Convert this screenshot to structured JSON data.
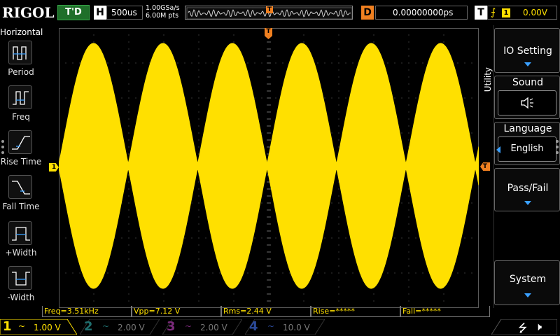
{
  "brand": "RIGOL",
  "topbar": {
    "run_state": "T'D",
    "horizontal_label": "H",
    "timebase": "500us",
    "sample_rate": "1.00GSa/s",
    "memory_depth": "6.00M pts",
    "delay_label": "D",
    "delay_value": "0.00000000ps",
    "trigger_label": "T",
    "trigger_source": "1",
    "trigger_level": "0.00V",
    "trigger_marker": "T"
  },
  "left_panel": {
    "title": "Horizontal",
    "items": [
      {
        "label": "Period",
        "icon": "period-icon"
      },
      {
        "label": "Freq",
        "icon": "freq-icon"
      },
      {
        "label": "Rise Time",
        "icon": "rise-time-icon"
      },
      {
        "label": "Fall Time",
        "icon": "fall-time-icon"
      },
      {
        "label": "+Width",
        "icon": "positive-width-icon"
      },
      {
        "label": "-Width",
        "icon": "negative-width-icon"
      }
    ]
  },
  "markers": {
    "ch1": "1",
    "trigger": "T"
  },
  "waveform": {
    "color": "#ffe000",
    "bursts": 6
  },
  "measurements": [
    {
      "text": "Freq=3.51kHz"
    },
    {
      "text": "Vpp=7.12 V"
    },
    {
      "text": "Rms=2.44 V"
    },
    {
      "text": "Rise=*****"
    },
    {
      "text": "Fall=*****"
    }
  ],
  "channels": [
    {
      "num": "1",
      "coupling": "~",
      "scale": "1.00 V",
      "color": "#ffe000",
      "active": true
    },
    {
      "num": "2",
      "coupling": "~",
      "scale": "2.00 V",
      "color": "#2aa3a3",
      "active": false
    },
    {
      "num": "3",
      "coupling": "~",
      "scale": "2.00 V",
      "color": "#c030c0",
      "active": false
    },
    {
      "num": "4",
      "coupling": "~",
      "scale": "10.0 V",
      "color": "#3060e0",
      "active": false
    }
  ],
  "right_menu": {
    "tab": "Utility",
    "io_setting": "IO Setting",
    "sound": "Sound",
    "sound_icon": "speaker-icon",
    "language": "Language",
    "language_value": "English",
    "pass_fail": "Pass/Fail",
    "system": "System"
  },
  "status_icons": [
    "usb-icon",
    "speaker-icon"
  ]
}
